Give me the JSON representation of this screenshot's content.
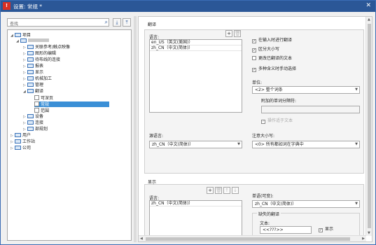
{
  "window": {
    "title": "设置: 常规 *",
    "icon_glyph": "!"
  },
  "search": {
    "placeholder": "查找"
  },
  "tree": {
    "root": "项目",
    "items": [
      "关联参考/触点映像",
      "图形的编辑",
      "待布线的连接",
      "报表",
      "显示",
      "机械加工",
      "管理",
      "翻译",
      "可深页",
      "常规",
      "范围",
      "设备",
      "连接",
      "部规划"
    ],
    "bottom": [
      "用户",
      "工作站",
      "公司"
    ]
  },
  "translation": {
    "group_title": "翻译",
    "language_label": "语言:",
    "languages": [
      "en_US（英文(美国)）",
      "zh_CN（中文(简体)）"
    ],
    "source_label": "源语言:",
    "source_value": "zh_CN（中文(简体)）",
    "cb_translate_on_input": "在输入时进行翻译",
    "cb_case_sensitive": "区分大小写",
    "cb_manual_translated": "更改已翻译的文本",
    "cb_multi_manual": "多种含义时手动选择",
    "unit_label": "单位:",
    "unit_value": "<2> 整个词条",
    "separator_label": "附加的单词分隔符:",
    "cb_only_text": "操作适于文本",
    "case_label": "注意大小写:",
    "case_value": "<0> 所有都如词在字典中"
  },
  "display": {
    "group_title": "显示",
    "language_label": "语言:",
    "languages": [
      "zh_CN（中文(简体)）"
    ],
    "single_label": "单语(可变):",
    "single_value": "zh_CN（中文(简体)）",
    "missing_title": "缺失的翻译",
    "text_label": "文本:",
    "text_value": "<<???>>",
    "cb_show": "显示"
  }
}
